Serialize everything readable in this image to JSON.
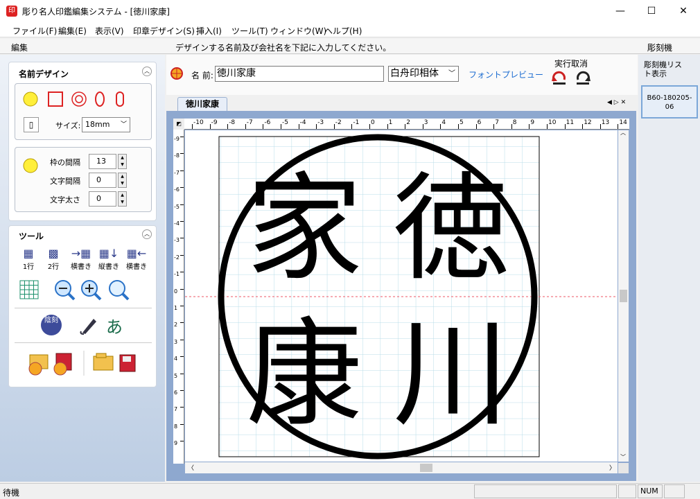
{
  "window": {
    "title": "彫り名人印鑑編集システム - [徳川家康]",
    "app_icon": "印",
    "minimize": "—",
    "maximize": "☐",
    "close": "✕"
  },
  "menu": [
    "ファイル(F)",
    "編集(E)",
    "表示(V)",
    "印章デザイン(S)",
    "挿入(I)",
    "ツール(T)",
    "ウィンドウ(W)",
    "ヘルプ(H)"
  ],
  "panes": {
    "left": "編集",
    "center": "デザインする名前及び会社名を下記に入力してください。",
    "right": "彫刻機"
  },
  "name_design": {
    "heading": "名前デザイン",
    "size_label": "サイズ:",
    "size_value": "18mm"
  },
  "spacing": {
    "frame_label": "枠の間隔",
    "frame_value": "13",
    "char_label": "文字間隔",
    "char_value": "0",
    "weight_label": "文字太さ",
    "weight_value": "0"
  },
  "tools": {
    "heading": "ツール",
    "items": [
      "1行",
      "2行",
      "横書き",
      "縦書き",
      "横書き"
    ],
    "inkan_label": "陰刻",
    "kana_label": "あ"
  },
  "name_input": {
    "label": "名 前:",
    "value": "徳川家康",
    "font": "白舟印相体",
    "preview": "フォントプレビュー",
    "undo": "実行取消"
  },
  "doc_tab": "徳川家康",
  "ruler_h": [
    "-10",
    "-9",
    "-8",
    "-7",
    "-6",
    "-5",
    "-4",
    "-3",
    "-2",
    "-1",
    "0",
    "1",
    "2",
    "3",
    "4",
    "5",
    "6",
    "7",
    "8",
    "9",
    "10",
    "11",
    "12",
    "13",
    "14"
  ],
  "ruler_v": [
    "-9",
    "-8",
    "-7",
    "-6",
    "-5",
    "-4",
    "-3",
    "-2",
    "-1",
    "0",
    "1",
    "2",
    "3",
    "4",
    "5",
    "6",
    "7",
    "8",
    "9"
  ],
  "seal_text": [
    "徳",
    "川",
    "家",
    "康"
  ],
  "right_panel": {
    "list_label": "彫刻機リスト表示",
    "device": "B60-180205-06"
  },
  "status": {
    "text": "待機",
    "num": "NUM"
  }
}
